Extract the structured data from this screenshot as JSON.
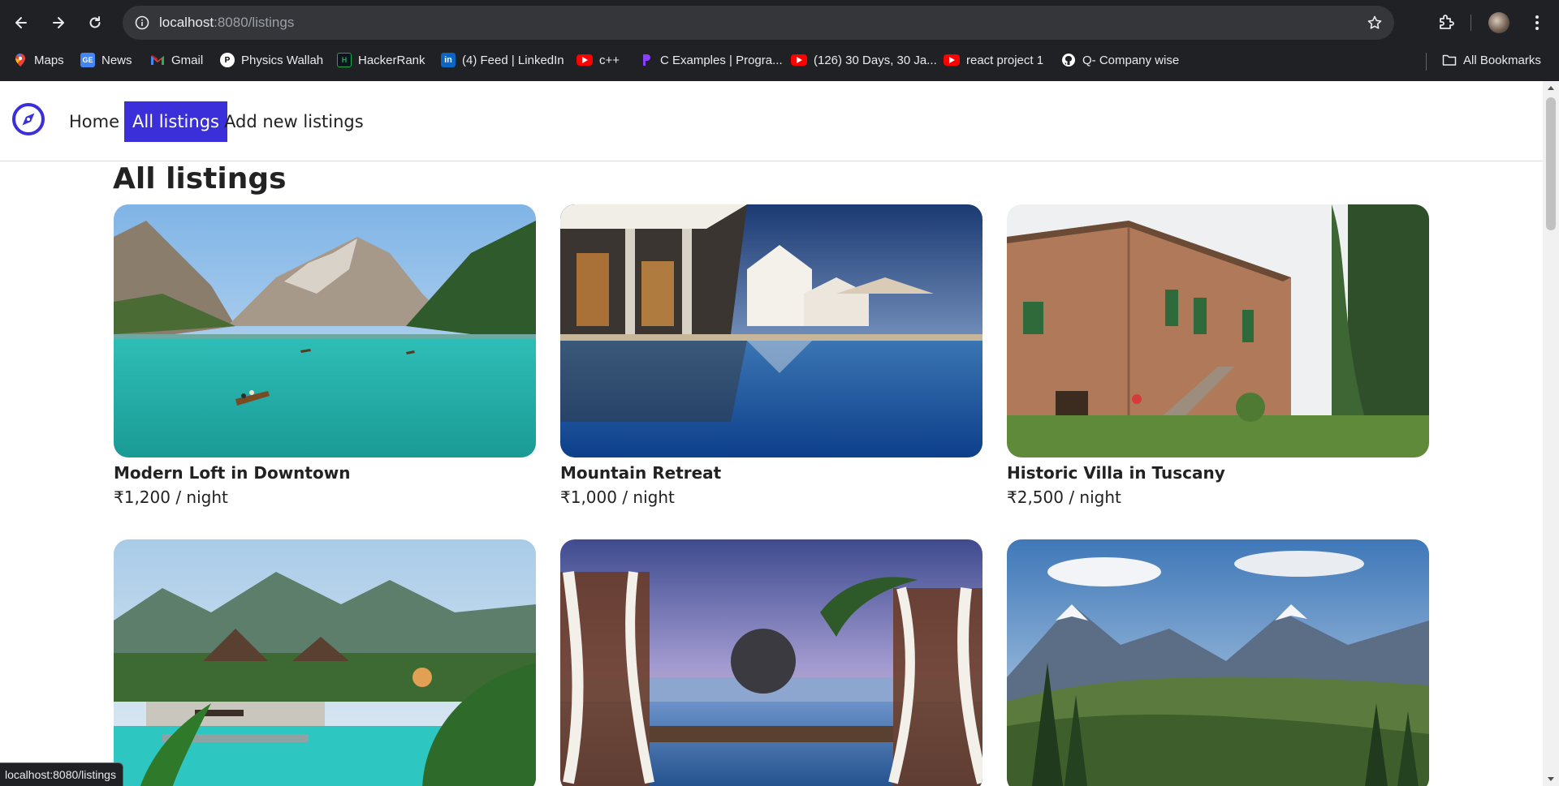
{
  "browser": {
    "url_host": "localhost",
    "url_rest": ":8080/listings",
    "status_url": "localhost:8080/listings",
    "bookmarks": [
      {
        "label": "Maps",
        "icon": "maps-icon",
        "color": "#34a853"
      },
      {
        "label": "News",
        "icon": "news-icon",
        "color": "#4285f4"
      },
      {
        "label": "Gmail",
        "icon": "gmail-icon",
        "color": "#ea4335"
      },
      {
        "label": "Physics Wallah",
        "icon": "physics-wallah-icon",
        "color": "#ffffff"
      },
      {
        "label": "HackerRank",
        "icon": "hackerrank-icon",
        "color": "#1ba94c"
      },
      {
        "label": "(4) Feed | LinkedIn",
        "icon": "linkedin-icon",
        "color": "#0a66c2"
      },
      {
        "label": "c++",
        "icon": "youtube-icon",
        "color": "#ff0000"
      },
      {
        "label": "C Examples | Progra...",
        "icon": "programiz-icon",
        "color": "#8a3ffc"
      },
      {
        "label": "(126) 30 Days, 30 Ja...",
        "icon": "youtube-icon",
        "color": "#ff0000"
      },
      {
        "label": "react project 1",
        "icon": "youtube-icon",
        "color": "#ff0000"
      },
      {
        "label": "Q- Company wise",
        "icon": "github-icon",
        "color": "#ffffff"
      }
    ],
    "all_bookmarks": "All Bookmarks"
  },
  "site": {
    "nav": {
      "home": "Home",
      "all_listings": "All listings",
      "add_new": "Add new listings",
      "accent": "#3a2fd8"
    },
    "heading": "All listings",
    "listings": [
      {
        "title": "Modern Loft in Downtown",
        "price": "₹1,200 / night",
        "scene": "lake"
      },
      {
        "title": "Mountain Retreat",
        "price": "₹1,000 / night",
        "scene": "resort-pool"
      },
      {
        "title": "Historic Villa in Tuscany",
        "price": "₹2,500 / night",
        "scene": "villa"
      },
      {
        "title": "",
        "price": "",
        "scene": "tropical-pool"
      },
      {
        "title": "",
        "price": "",
        "scene": "cabana-sunset"
      },
      {
        "title": "",
        "price": "",
        "scene": "mountains"
      }
    ]
  }
}
